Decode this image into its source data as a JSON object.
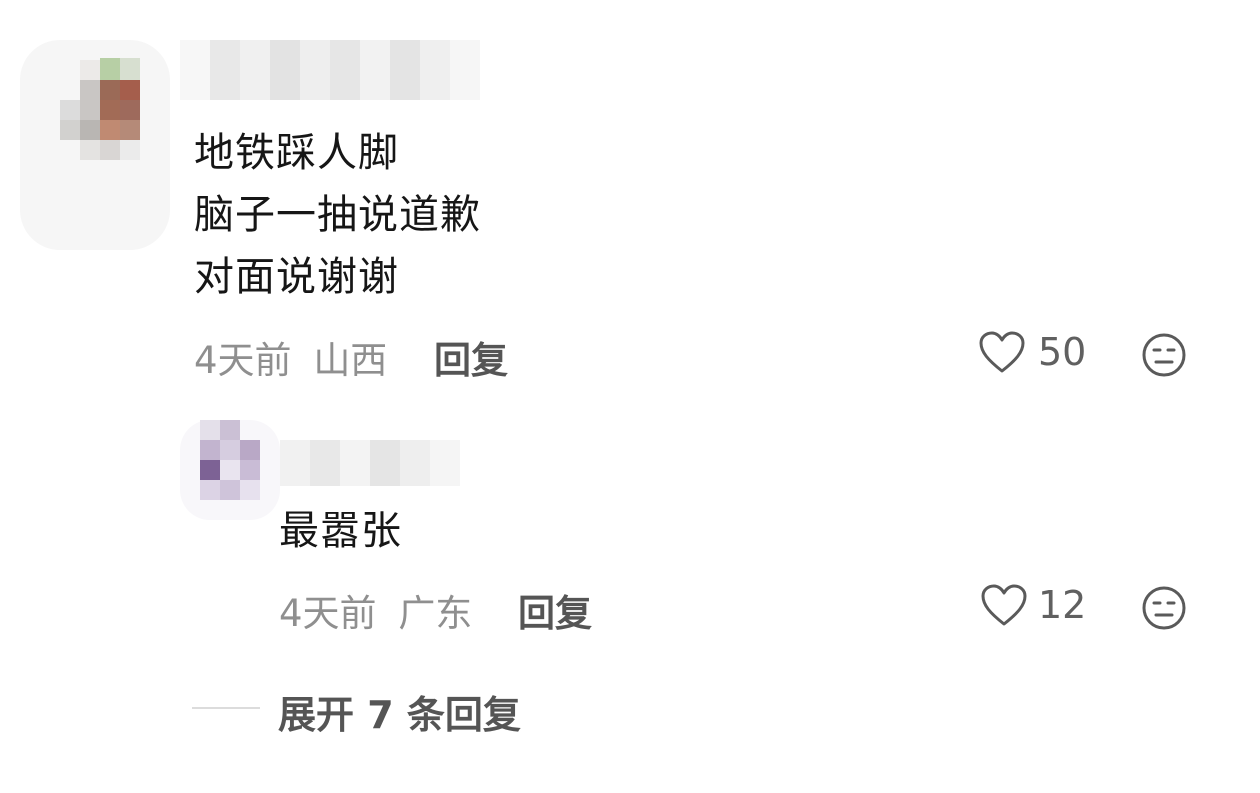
{
  "comment": {
    "lines": [
      "地铁踩人脚",
      "脑子一抽说道歉",
      "对面说谢谢"
    ],
    "time": "4天前",
    "location": "山西",
    "reply_label": "回复",
    "like_count": "50"
  },
  "reply": {
    "text": "最嚣张",
    "time": "4天前",
    "location": "广东",
    "reply_label": "回复",
    "like_count": "12"
  },
  "expand": {
    "label": "展开 7 条回复"
  },
  "icons": {
    "like": "heart-outline-icon",
    "dislike": "meh-face-icon"
  },
  "colors": {
    "text": "#161616",
    "meta": "#8f8f8f",
    "action": "#555555"
  }
}
